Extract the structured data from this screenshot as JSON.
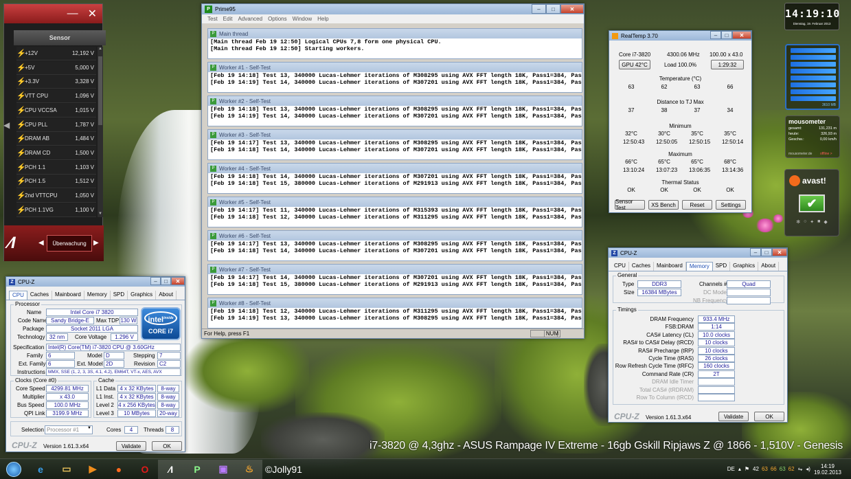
{
  "sensor": {
    "column_header": "Sensor",
    "minimize": "—",
    "close": "✕",
    "rows": [
      {
        "name": "+12V",
        "value": "12,192 V"
      },
      {
        "name": "+5V",
        "value": "5,000 V"
      },
      {
        "name": "+3.3V",
        "value": "3,328 V"
      },
      {
        "name": "VTT CPU",
        "value": "1,096 V"
      },
      {
        "name": "CPU VCCSA",
        "value": "1,015 V"
      },
      {
        "name": "CPU PLL",
        "value": "1,787 V"
      },
      {
        "name": "DRAM AB",
        "value": "1,484 V"
      },
      {
        "name": "DRAM CD",
        "value": "1,500 V"
      },
      {
        "name": "PCH 1.1",
        "value": "1,103 V"
      },
      {
        "name": "PCH 1.5",
        "value": "1,512 V"
      },
      {
        "name": "2nd VTTCPU",
        "value": "1,050 V"
      },
      {
        "name": "PCH 1.1VG",
        "value": "1,100 V"
      }
    ],
    "mode_label": "Überwachung"
  },
  "prime95": {
    "title": "Prime95",
    "menu": [
      "Test",
      "Edit",
      "Advanced",
      "Options",
      "Window",
      "Help"
    ],
    "status_left": "For Help, press F1",
    "status_num": "NUM",
    "threads": [
      {
        "title": "Main thread",
        "lines": [
          "[Main thread Feb 19 12:50] Logical CPUs 7,8 form one physical CPU.",
          "[Main thread Feb 19 12:50] Starting workers."
        ]
      },
      {
        "title": "Worker #1 - Self-Test",
        "lines": [
          "[Feb 19 14:18] Test 13, 340000 Lucas-Lehmer iterations of M308295 using AVX FFT length 18K, Pass1=384, Pass2=48.",
          "[Feb 19 14:19] Test 14, 340000 Lucas-Lehmer iterations of M307201 using AVX FFT length 18K, Pass1=384, Pass2=48."
        ]
      },
      {
        "title": "Worker #2 - Self-Test",
        "lines": [
          "[Feb 19 14:18] Test 13, 340000 Lucas-Lehmer iterations of M308295 using AVX FFT length 18K, Pass1=384, Pass2=48.",
          "[Feb 19 14:19] Test 14, 340000 Lucas-Lehmer iterations of M307201 using AVX FFT length 18K, Pass1=384, Pass2=48."
        ]
      },
      {
        "title": "Worker #3 - Self-Test",
        "lines": [
          "[Feb 19 14:17] Test 13, 340000 Lucas-Lehmer iterations of M308295 using AVX FFT length 18K, Pass1=384, Pass2=48.",
          "[Feb 19 14:18] Test 14, 340000 Lucas-Lehmer iterations of M307201 using AVX FFT length 18K, Pass1=384, Pass2=48."
        ]
      },
      {
        "title": "Worker #4 - Self-Test",
        "lines": [
          "[Feb 19 14:18] Test 14, 340000 Lucas-Lehmer iterations of M307201 using AVX FFT length 18K, Pass1=384, Pass2=48.",
          "[Feb 19 14:18] Test 15, 380000 Lucas-Lehmer iterations of M291913 using AVX FFT length 18K, Pass1=384, Pass2=48."
        ]
      },
      {
        "title": "Worker #5 - Self-Test",
        "lines": [
          "[Feb 19 14:17] Test 11, 340000 Lucas-Lehmer iterations of M315393 using AVX FFT length 18K, Pass1=384, Pass2=48.",
          "[Feb 19 14:18] Test 12, 340000 Lucas-Lehmer iterations of M311295 using AVX FFT length 18K, Pass1=384, Pass2=48."
        ]
      },
      {
        "title": "Worker #6 - Self-Test",
        "lines": [
          "[Feb 19 14:17] Test 13, 340000 Lucas-Lehmer iterations of M308295 using AVX FFT length 18K, Pass1=384, Pass2=48.",
          "[Feb 19 14:18] Test 14, 340000 Lucas-Lehmer iterations of M307201 using AVX FFT length 18K, Pass1=384, Pass2=48."
        ]
      },
      {
        "title": "Worker #7 - Self-Test",
        "lines": [
          "[Feb 19 14:17] Test 14, 340000 Lucas-Lehmer iterations of M307201 using AVX FFT length 18K, Pass1=384, Pass2=48.",
          "[Feb 19 14:18] Test 15, 380000 Lucas-Lehmer iterations of M291913 using AVX FFT length 18K, Pass1=384, Pass2=48."
        ]
      },
      {
        "title": "Worker #8 - Self-Test",
        "lines": [
          "[Feb 19 14:18] Test 12, 340000 Lucas-Lehmer iterations of M311295 using AVX FFT length 18K, Pass1=384, Pass2=48.",
          "[Feb 19 14:19] Test 13, 340000 Lucas-Lehmer iterations of M308295 using AVX FFT length 18K, Pass1=384, Pass2=48."
        ]
      }
    ]
  },
  "realtemp": {
    "title": "RealTemp 3.70",
    "cpu": "Core i7-3820",
    "freq": "4300.06 MHz",
    "mult": "100.00 x 43.0",
    "gpu_btn": "GPU 42°C",
    "load": "Load 100.0%",
    "time_btn": "1:29:32",
    "temp_header": "Temperature (°C)",
    "temps": [
      "63",
      "62",
      "63",
      "66"
    ],
    "dist_header": "Distance to TJ Max",
    "dist": [
      "37",
      "38",
      "37",
      "34"
    ],
    "min_header": "Minimum",
    "min": [
      "32°C",
      "30°C",
      "35°C",
      "35°C"
    ],
    "min_time": [
      "12:50:43",
      "12:50:05",
      "12:50:15",
      "12:50:14"
    ],
    "max_header": "Maximum",
    "max": [
      "66°C",
      "65°C",
      "65°C",
      "68°C"
    ],
    "max_time": [
      "13:10:24",
      "13:07:23",
      "13:06:35",
      "13:14:36"
    ],
    "status_header": "Thermal Status",
    "status": [
      "OK",
      "OK",
      "OK",
      "OK"
    ],
    "buttons": [
      "Sensor Test",
      "XS Bench",
      "Reset",
      "Settings"
    ]
  },
  "cpuz_cpu": {
    "title": "CPU-Z",
    "tabs": [
      "CPU",
      "Caches",
      "Mainboard",
      "Memory",
      "SPD",
      "Graphics",
      "About"
    ],
    "processor_group": "Processor",
    "name_label": "Name",
    "name": "Intel Core i7 3820",
    "codename_label": "Code Name",
    "codename": "Sandy Bridge-E",
    "tdp_label": "Max TDP",
    "tdp": "130 W",
    "package_label": "Package",
    "package": "Socket 2011 LGA",
    "tech_label": "Technology",
    "tech": "32 nm",
    "voltage_label": "Core Voltage",
    "voltage": "1.296 V",
    "spec_label": "Specification",
    "spec": "Intel(R) Core(TM) i7-3820 CPU @ 3.60GHz",
    "family_label": "Family",
    "family": "6",
    "model_label": "Model",
    "model": "D",
    "stepping_label": "Stepping",
    "stepping": "7",
    "extfamily_label": "Ext. Family",
    "extfamily": "6",
    "extmodel_label": "Ext. Model",
    "extmodel": "2D",
    "revision_label": "Revision",
    "revision": "C2",
    "instr_label": "Instructions",
    "instr": "MMX, SSE (1, 2, 3, 3S, 4.1, 4.2), EM64T, VT-x, AES, AVX",
    "clocks_group": "Clocks (Core #0)",
    "cache_group": "Cache",
    "corespeed_label": "Core Speed",
    "corespeed": "4299.81 MHz",
    "mult_label": "Multiplier",
    "mult": "x 43.0",
    "bus_label": "Bus Speed",
    "bus": "100.0 MHz",
    "qpi_label": "QPI Link",
    "qpi": "3199.9 MHz",
    "l1d_label": "L1 Data",
    "l1d": "4 x 32 KBytes",
    "l1d_way": "8-way",
    "l1i_label": "L1 Inst.",
    "l1i": "4 x 32 KBytes",
    "l1i_way": "8-way",
    "l2_label": "Level 2",
    "l2": "4 x 256 KBytes",
    "l2_way": "8-way",
    "l3_label": "Level 3",
    "l3": "10 MBytes",
    "l3_way": "20-way",
    "selection_label": "Selection",
    "selection": "Processor #1",
    "cores_label": "Cores",
    "cores": "4",
    "threads_label": "Threads",
    "threads": "8",
    "logo": "CPU-Z",
    "version": "Version 1.61.3.x64",
    "validate": "Validate",
    "ok": "OK",
    "intel_badge_top": "intel",
    "intel_badge_inside": "inside",
    "intel_badge_bottom": "CORE i7"
  },
  "cpuz_mem": {
    "title": "CPU-Z",
    "tabs": [
      "CPU",
      "Caches",
      "Mainboard",
      "Memory",
      "SPD",
      "Graphics",
      "About"
    ],
    "general_group": "General",
    "type_label": "Type",
    "type": "DDR3",
    "channels_label": "Channels #",
    "channels": "Quad",
    "size_label": "Size",
    "size": "16384 MBytes",
    "dcmode_label": "DC Mode",
    "nbfreq_label": "NB Frequency",
    "timings_group": "Timings",
    "timings": [
      {
        "label": "DRAM Frequency",
        "value": "933.4 MHz"
      },
      {
        "label": "FSB:DRAM",
        "value": "1:14"
      },
      {
        "label": "CAS# Latency (CL)",
        "value": "10.0 clocks"
      },
      {
        "label": "RAS# to CAS# Delay (tRCD)",
        "value": "10 clocks"
      },
      {
        "label": "RAS# Precharge (tRP)",
        "value": "10 clocks"
      },
      {
        "label": "Cycle Time (tRAS)",
        "value": "26 clocks"
      },
      {
        "label": "Row Refresh Cycle Time (tRFC)",
        "value": "160 clocks"
      },
      {
        "label": "Command Rate (CR)",
        "value": "2T"
      },
      {
        "label": "DRAM Idle Timer",
        "value": ""
      },
      {
        "label": "Total CAS# (tRDRAM)",
        "value": ""
      },
      {
        "label": "Row To Column (tRCD)",
        "value": ""
      }
    ],
    "logo": "CPU-Z",
    "version": "Version 1.61.3.x64",
    "validate": "Validate",
    "ok": "OK"
  },
  "clock": {
    "time": "14:19:10",
    "date": "Dienstag, 19. Februar 2013"
  },
  "meter": {
    "readout": "3610 MB"
  },
  "mousometer": {
    "title": "mousometer",
    "rows": [
      {
        "label": "gesamt:",
        "value": "131,231 m"
      },
      {
        "label": "heute:",
        "value": "326,93 m"
      },
      {
        "label": "Geschw.:",
        "value": "0,00 km/h"
      }
    ],
    "footer": "mousometer.de",
    "footer2": "offline >"
  },
  "avast": {
    "label": "avast!"
  },
  "caption": "i7-3820 @ 4,3ghz - ASUS Rampage IV Extreme - 16gb Gskill Ripjaws Z @ 1866 - 1,510V - Genesis",
  "taskbar": {
    "user": "©Jolly91",
    "lang": "DE",
    "temps": [
      "42",
      "63",
      "66",
      "63",
      "62"
    ],
    "time": "14:19",
    "date": "19.02.2013"
  }
}
